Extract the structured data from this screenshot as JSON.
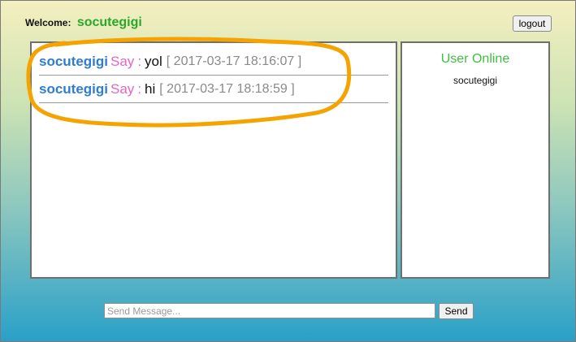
{
  "header": {
    "welcome_label": "Welcome:",
    "username": "socutegigi",
    "logout_label": "logout"
  },
  "messages": [
    {
      "user": "socutegigi",
      "say": "Say",
      "colon": ":",
      "text": "yol",
      "time": "[ 2017-03-17 18:16:07 ]"
    },
    {
      "user": "socutegigi",
      "say": "Say",
      "colon": ":",
      "text": "hi",
      "time": "[ 2017-03-17 18:18:59 ]"
    }
  ],
  "online": {
    "title": "User Online",
    "users": [
      "socutegigi"
    ]
  },
  "composer": {
    "placeholder": "Send Message...",
    "send_label": "Send"
  },
  "colors": {
    "username": "#2f7dd0",
    "say": "#e366c0",
    "timestamp": "#8a8a8a",
    "welcome_user": "#2aa82a",
    "online_title": "#3fbf3f",
    "highlight": "#f5a300"
  }
}
